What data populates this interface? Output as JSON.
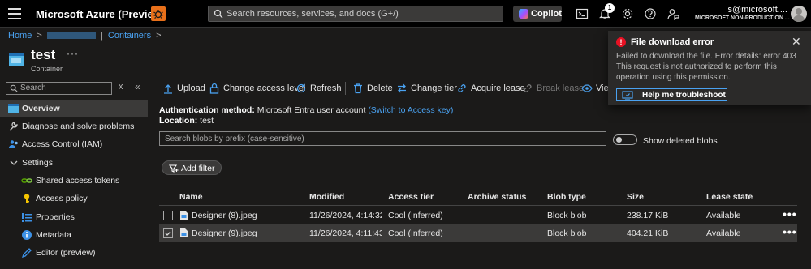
{
  "topbar": {
    "app_title": "Microsoft Azure (Preview)",
    "search_placeholder": "Search resources, services, and docs (G+/)",
    "copilot_label": "Copilot",
    "notification_count": "1",
    "account_email": "s@microsoft....",
    "account_directory": "MICROSOFT NON-PRODUCTION ..."
  },
  "breadcrumb": {
    "home": "Home",
    "containers": "Containers"
  },
  "resource": {
    "title": "test",
    "subtitle": "Container",
    "more": "···"
  },
  "sidebar": {
    "search_placeholder": "Search",
    "clear": "x",
    "collapse": "«",
    "items": [
      {
        "label": "Overview",
        "icon": "container-icon"
      },
      {
        "label": "Diagnose and solve problems",
        "icon": "wrench-icon"
      },
      {
        "label": "Access Control (IAM)",
        "icon": "people-icon"
      },
      {
        "label": "Settings",
        "icon": "chevron-down-icon"
      },
      {
        "label": "Shared access tokens",
        "icon": "link-icon"
      },
      {
        "label": "Access policy",
        "icon": "key-icon"
      },
      {
        "label": "Properties",
        "icon": "properties-icon"
      },
      {
        "label": "Metadata",
        "icon": "info-icon"
      },
      {
        "label": "Editor (preview)",
        "icon": "pencil-icon"
      }
    ]
  },
  "commands": {
    "upload": "Upload",
    "change_access_level": "Change access level",
    "refresh": "Refresh",
    "delete": "Delete",
    "change_tier": "Change tier",
    "acquire_lease": "Acquire lease",
    "break_lease": "Break lease",
    "view": "View"
  },
  "info": {
    "auth_label": "Authentication method:",
    "auth_value": "Microsoft Entra user account",
    "auth_link": "(Switch to Access key)",
    "location_label": "Location:",
    "location_value": "test"
  },
  "blob_search_placeholder": "Search blobs by prefix (case-sensitive)",
  "show_deleted_label": "Show deleted blobs",
  "add_filter_label": "Add filter",
  "table": {
    "headers": [
      "Name",
      "Modified",
      "Access tier",
      "Archive status",
      "Blob type",
      "Size",
      "Lease state"
    ],
    "rows": [
      {
        "name": "Designer (8).jpeg",
        "modified": "11/26/2024, 4:14:32 ...",
        "tier": "Cool (Inferred)",
        "archive": "",
        "type": "Block blob",
        "size": "238.17 KiB",
        "lease": "Available",
        "selected": false
      },
      {
        "name": "Designer (9).jpeg",
        "modified": "11/26/2024, 4:11:43 ...",
        "tier": "Cool (Inferred)",
        "archive": "",
        "type": "Block blob",
        "size": "404.21 KiB",
        "lease": "Available",
        "selected": true
      }
    ],
    "row_more": "•••"
  },
  "toast": {
    "title": "File download error",
    "message": "Failed to download the file. Error details: error 403 This request is not authorized to perform this operation using this permission.",
    "button": "Help me troubleshoot",
    "error_glyph": "!",
    "close_glyph": "✕"
  },
  "colors": {
    "accent": "#4aa2f1",
    "error": "#e81123",
    "bug_badge": "#e8701a"
  }
}
